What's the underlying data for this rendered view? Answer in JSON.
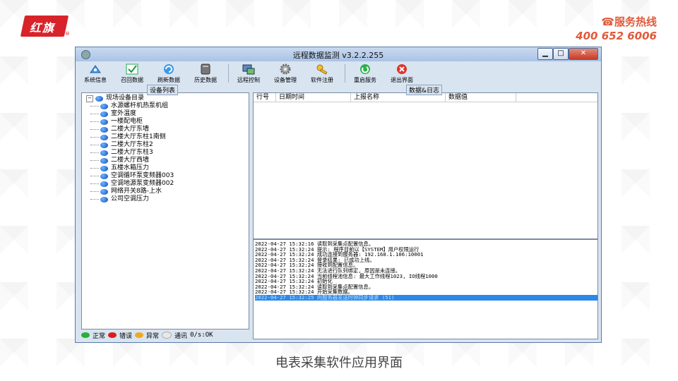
{
  "brand": {
    "logo_text": "红旗",
    "hotline_label": "服务热线",
    "hotline_number": "400 652 6006"
  },
  "caption": "电表采集软件应用界面",
  "window": {
    "title": "远程数据监测 v3.2.2.255"
  },
  "toolbar": [
    {
      "label": "系统信息",
      "icon": "satellite-icon"
    },
    {
      "label": "召回数据",
      "icon": "checkbox-icon"
    },
    {
      "label": "刷新数据",
      "icon": "refresh-icon"
    },
    {
      "label": "历史数据",
      "icon": "database-icon"
    },
    {
      "label": "远程控制",
      "icon": "remote-icon"
    },
    {
      "label": "设备管理",
      "icon": "gear-icon"
    },
    {
      "label": "软件注册",
      "icon": "key-icon"
    },
    {
      "label": "重启服务",
      "icon": "restart-icon"
    },
    {
      "label": "退出界面",
      "icon": "exit-icon"
    }
  ],
  "device_panel": {
    "title": "设备列表",
    "root": "现场设备目录",
    "items": [
      "水源螺杆机热泵机组",
      "室外温度",
      "一楼配电柜",
      "二楼大厅东墙",
      "二楼大厅东柱1南侧",
      "二楼大厅东柱2",
      "二楼大厅东柱3",
      "二楼大厅西墙",
      "五楼水箱压力",
      "空调循环泵变频器003",
      "空调地源泵变频器002",
      "网络开关8路-上水",
      "公司空调压力"
    ]
  },
  "data_panel": {
    "title": "数据&日志",
    "columns": [
      "行号",
      "日期时间",
      "上报名称",
      "数据值"
    ]
  },
  "legend": {
    "normal": "正常",
    "error": "错误",
    "abnormal": "异常",
    "comm": "通讯",
    "rate": "0/s:OK"
  },
  "log": [
    "2022-04-27 15:32:16 读取到采集点配置信息。",
    "2022-04-27 15:32:24 提示: 程序目前以【SYSTEM】用户权限运行",
    "2022-04-27 15:32:24 成功连接到服务器: 192.168.1.106:10001",
    "2022-04-27 15:32:24 登录结果: 已成功上线。",
    "2022-04-27 15:32:24 接收到配置信息。",
    "2022-04-27 15:32:24 无法进行队列绑定, 原因是未连接。",
    "2022-04-27 15:32:24 当前线程池信息: 最大工作线程1023, IO线程1000",
    "2022-04-27 15:32:24 初始化",
    "2022-04-27 15:32:24 读取到采集点配置信息。",
    "2022-04-27 15:32:24 开始采集数据。",
    "2022-04-27 15:32:25 向服务器发送时钟同步请求 (51)"
  ]
}
